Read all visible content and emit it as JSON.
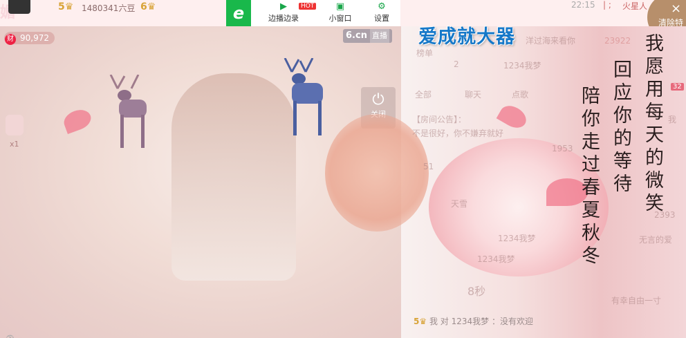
{
  "topbar": {
    "title_ghost": "媚",
    "level_left": "5",
    "uid": "1480341",
    "liudou": "六豆",
    "level_right": "6",
    "time": "22:15",
    "separators": "| ;",
    "star_label": "火星人"
  },
  "toolbar": {
    "logo": "e",
    "items": [
      {
        "label": "边播边录"
      },
      {
        "label": "小窗口"
      },
      {
        "label": "设置"
      }
    ],
    "hot_badge": "HOT"
  },
  "clear_button": {
    "close": "×",
    "label": "清除特"
  },
  "stream": {
    "viewer_badge": "财",
    "viewer_count": "90,972",
    "logo": "6.cn",
    "live_label": "直播",
    "gift_count": "x1",
    "power_label": "关闭"
  },
  "chat": {
    "headline": "爱成就大器",
    "ghost_lines": [
      "榜单",
      "洋过海来看你",
      "23922",
      "2",
      "1234我梦",
      "全部",
      "聊天",
      "点歌",
      "【房间公告】：",
      "不是很好，你不嫌弃就好",
      "我",
      "1953",
      "天雪",
      "51",
      "1234我梦",
      "2393",
      "无言的爱",
      "1234我梦",
      "8秒",
      "有幸自由一寸"
    ],
    "poem_columns": [
      "我愿用每天的微笑",
      "回应你的等待",
      "陪你走过春夏秋冬"
    ],
    "badge_count": "32",
    "bottom_line": {
      "level": "5",
      "text1": "我 对",
      "user": "1234我梦",
      "text2": "：没有欢迎"
    }
  }
}
